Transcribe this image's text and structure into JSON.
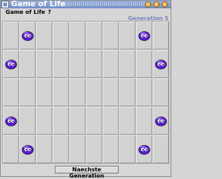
{
  "window": {
    "title": "Game of Life"
  },
  "menu": {
    "items": [
      "Game of Life",
      "?"
    ]
  },
  "status": {
    "generation": "Generation 5"
  },
  "board": {
    "cols": 10,
    "rows": 5,
    "live_cells": [
      [
        0,
        1
      ],
      [
        0,
        8
      ],
      [
        1,
        0
      ],
      [
        1,
        9
      ],
      [
        3,
        0
      ],
      [
        3,
        9
      ],
      [
        4,
        1
      ],
      [
        4,
        8
      ]
    ],
    "creature_icon": "purple-blob-creature",
    "creature_color": "#5a1fc8"
  },
  "actions": {
    "next_generation": "Naechste Generation"
  }
}
